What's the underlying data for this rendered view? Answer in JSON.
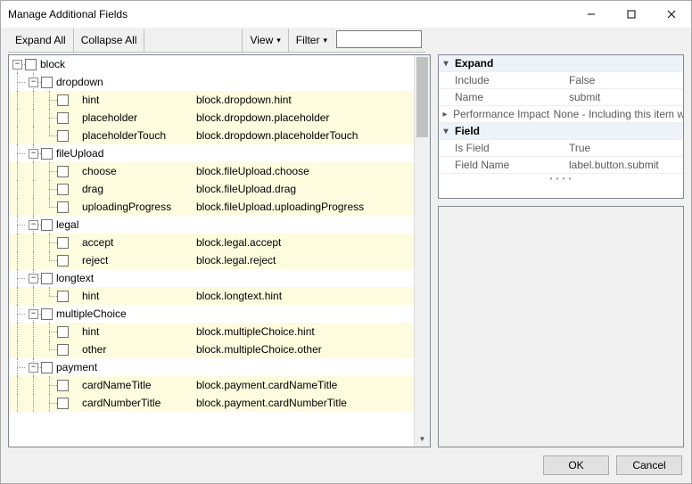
{
  "window": {
    "title": "Manage Additional Fields"
  },
  "toolbar": {
    "expand_all": "Expand All",
    "collapse_all": "Collapse All",
    "view": "View",
    "filter": "Filter",
    "filter_value": ""
  },
  "tree": [
    {
      "type": "root",
      "label": "block",
      "expanded": true
    },
    {
      "type": "group",
      "label": "dropdown",
      "expanded": true
    },
    {
      "type": "leaf",
      "label": "hint",
      "path": "block.dropdown.hint",
      "striped": true
    },
    {
      "type": "leaf",
      "label": "placeholder",
      "path": "block.dropdown.placeholder",
      "striped": true
    },
    {
      "type": "leaf",
      "label": "placeholderTouch",
      "path": "block.dropdown.placeholderTouch",
      "striped": true,
      "last": true
    },
    {
      "type": "group",
      "label": "fileUpload",
      "expanded": true
    },
    {
      "type": "leaf",
      "label": "choose",
      "path": "block.fileUpload.choose",
      "striped": true
    },
    {
      "type": "leaf",
      "label": "drag",
      "path": "block.fileUpload.drag",
      "striped": true
    },
    {
      "type": "leaf",
      "label": "uploadingProgress",
      "path": "block.fileUpload.uploadingProgress",
      "striped": true,
      "last": true
    },
    {
      "type": "group",
      "label": "legal",
      "expanded": true
    },
    {
      "type": "leaf",
      "label": "accept",
      "path": "block.legal.accept",
      "striped": true
    },
    {
      "type": "leaf",
      "label": "reject",
      "path": "block.legal.reject",
      "striped": true,
      "last": true
    },
    {
      "type": "group",
      "label": "longtext",
      "expanded": true
    },
    {
      "type": "leaf",
      "label": "hint",
      "path": "block.longtext.hint",
      "striped": true,
      "last": true
    },
    {
      "type": "group",
      "label": "multipleChoice",
      "expanded": true
    },
    {
      "type": "leaf",
      "label": "hint",
      "path": "block.multipleChoice.hint",
      "striped": true
    },
    {
      "type": "leaf",
      "label": "other",
      "path": "block.multipleChoice.other",
      "striped": true,
      "last": true
    },
    {
      "type": "group",
      "label": "payment",
      "expanded": true
    },
    {
      "type": "leaf",
      "label": "cardNameTitle",
      "path": "block.payment.cardNameTitle",
      "striped": true
    },
    {
      "type": "leaf",
      "label": "cardNumberTitle",
      "path": "block.payment.cardNumberTitle",
      "striped": true
    }
  ],
  "properties": {
    "expand_header": "Expand",
    "include_k": "Include",
    "include_v": "False",
    "name_k": "Name",
    "name_v": "submit",
    "perf_k": "Performance Impact",
    "perf_v": "None - Including this item will h",
    "field_header": "Field",
    "isfield_k": "Is Field",
    "isfield_v": "True",
    "fieldname_k": "Field Name",
    "fieldname_v": "label.button.submit"
  },
  "footer": {
    "ok": "OK",
    "cancel": "Cancel"
  }
}
